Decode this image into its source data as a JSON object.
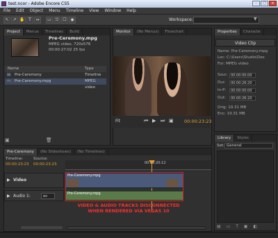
{
  "window": {
    "title": "test.ncor - Adobe Encore CS5",
    "buttons": [
      "–",
      "□",
      "✕"
    ]
  },
  "menu": [
    "File",
    "Edit",
    "Object",
    "Menu",
    "Timeline",
    "View",
    "Window",
    "Help"
  ],
  "toolbar": {
    "tools": [
      "↖",
      "↗",
      "✋",
      "T",
      "↔",
      "▭",
      "⎋",
      "☐",
      "◉"
    ],
    "workspace_label": "Workspace:"
  },
  "project": {
    "tabs": [
      "Project",
      "Menus",
      "Timelines",
      "Build"
    ],
    "clip_name": "Pre-Ceremony.mpg",
    "clip_info": [
      "MPEG video, 720x576",
      "00:00:27:02 25 fps"
    ],
    "columns": [
      "Name",
      "Type"
    ],
    "items": [
      {
        "name": "Pre-Ceremony",
        "type": "Timeline"
      },
      {
        "name": "Pre-Ceremony.mpg",
        "type": "MPEG video"
      }
    ]
  },
  "monitor": {
    "tabs": [
      "Monitor",
      "(No Menus)",
      "Flowchart"
    ],
    "fit": "Fit",
    "timecode": "00:00:23:23"
  },
  "properties": {
    "tabs": [
      "Properties",
      "Characte"
    ],
    "header": "Video Clip",
    "name": "Name: Pre-Ceremony.mpg",
    "loc": "Loc: C:\\Users\\Studio\\Des",
    "format": "For: MPEG video",
    "fields": [
      {
        "label": "Sour:",
        "value": "00:00:00:00"
      },
      {
        "label": "Dur:",
        "value": "00:00:26:20"
      },
      {
        "label": "In-P:",
        "value": "00:00:00:00"
      },
      {
        "label": "Out:",
        "value": "00:00:26:20"
      }
    ],
    "orig": "Orig: 19.31 MB",
    "enc": "Enc: 19.31 MB"
  },
  "library": {
    "tabs": [
      "Library",
      "Styles"
    ],
    "set_label": "Set:",
    "set_value": "General"
  },
  "timeline": {
    "tabs": [
      "Pre-Ceremony",
      "(No Slideshows)",
      "(No Timelines)"
    ],
    "timeline_label": "Timeline:",
    "source_label": "Source:",
    "timeline_tc": "00:00:23:23",
    "source_tc": "00:00:23:23",
    "ruler_tc": "00:00:20:12",
    "video_track": "Video",
    "audio_track": "Audio 1:",
    "audio_lang": "en",
    "video_clip": "Pre-Ceremony.mpg",
    "audio_clip": "Pre-Ceremony.mpg",
    "annotation": [
      "VIDEO & AUDIO TRACKS DISCONNECTED",
      "WHEN RENDERED VIA VEGAS 10"
    ]
  },
  "colors": {
    "accent": "#e39a2b",
    "annotation": "#d52222"
  }
}
